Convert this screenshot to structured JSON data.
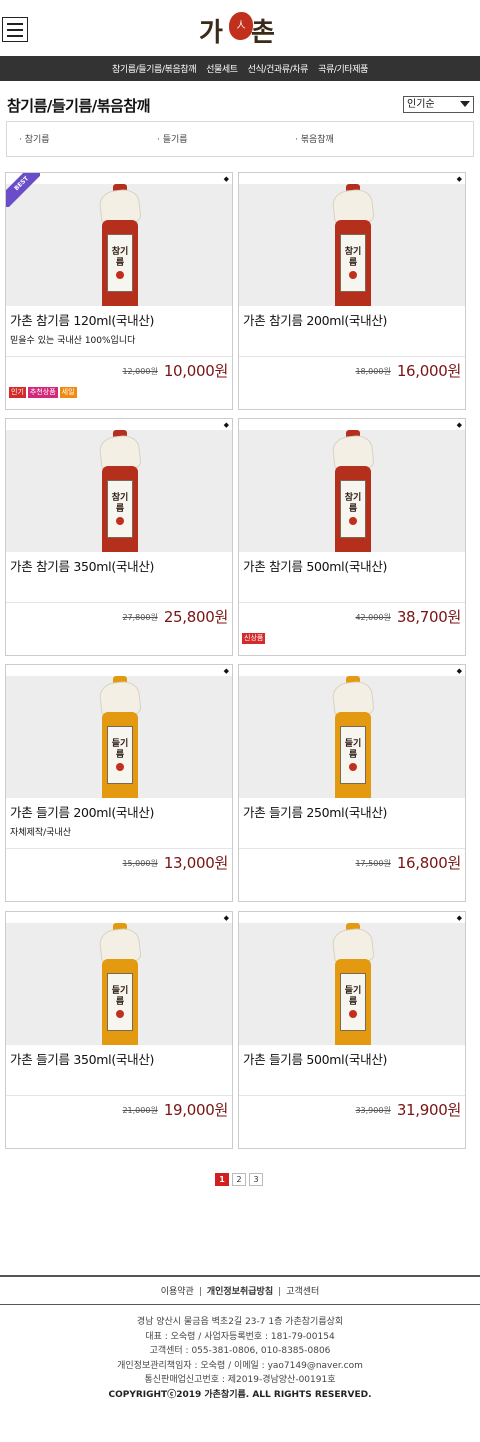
{
  "header": {
    "logo": {
      "text_left": "가",
      "text_right": "촌",
      "seal_text": "人"
    },
    "nav": [
      "참기름/들기름/볶음참깨",
      "선물세트",
      "선식/건과류/차류",
      "곡류/기타제품"
    ]
  },
  "category": {
    "title": "참기름/들기름/볶음참깨",
    "sort": {
      "selected": "인기순"
    },
    "subcategories": [
      "· 참기름",
      "· 들기름",
      "· 볶음참깨"
    ]
  },
  "products": [
    {
      "name": "가촌 참기름 120ml(국내산)",
      "desc": "믿을수 있는 국내산 100%입니다",
      "old_price": "12,000원",
      "price": "10,000원",
      "badges": [
        "인기",
        "추천상품",
        "세일"
      ],
      "best": "BEST",
      "oil": "sesame"
    },
    {
      "name": "가촌 참기름 200ml(국내산)",
      "desc": "",
      "old_price": "18,000원",
      "price": "16,000원",
      "badges": [],
      "oil": "sesame"
    },
    {
      "name": "가촌 참기름 350ml(국내산)",
      "desc": "",
      "old_price": "27,800원",
      "price": "25,800원",
      "badges": [],
      "oil": "sesame"
    },
    {
      "name": "가촌 참기름 500ml(국내산)",
      "desc": "",
      "old_price": "42,000원",
      "price": "38,700원",
      "badges": [
        "신상품"
      ],
      "oil": "sesame"
    },
    {
      "name": "가촌 들기름 200ml(국내산)",
      "desc": "자체제작/국내산",
      "old_price": "15,000원",
      "price": "13,000원",
      "badges": [],
      "oil": "perilla"
    },
    {
      "name": "가촌 들기름 250ml(국내산)",
      "desc": "",
      "old_price": "17,500원",
      "price": "16,800원",
      "badges": [],
      "oil": "perilla"
    },
    {
      "name": "가촌 들기름 350ml(국내산)",
      "desc": "",
      "old_price": "21,000원",
      "price": "19,000원",
      "badges": [],
      "oil": "perilla"
    },
    {
      "name": "가촌 들기름 500ml(국내산)",
      "desc": "",
      "old_price": "33,900원",
      "price": "31,900원",
      "badges": [],
      "oil": "perilla"
    }
  ],
  "bottle_labels": {
    "sesame": "참기름",
    "perilla": "들기름"
  },
  "colors": {
    "sesame": "#b5301c",
    "perilla": "#e39a10",
    "price": "#7a1414",
    "badge_인기": "#d42a2a",
    "badge_추천상품": "#d12a7a",
    "badge_세일": "#f08a10",
    "badge_신상품": "#d42a2a",
    "nav_bg": "#333333"
  },
  "pagination": {
    "pages": [
      "1",
      "2",
      "3"
    ],
    "current": "1"
  },
  "footer": {
    "links": [
      "이용약관",
      "개인정보취급방침",
      "고객센터"
    ],
    "info": [
      "경남 양산시 물금읍 벽초2길 23-7 1층 가촌참기름상회",
      "대표 : 오숙령 / 사업자등록번호 : 181-79-00154",
      "고객센터 : 055-381-0806, 010-8385-0806",
      "개인정보관리책임자 : 오숙령 / 이메일 : yao7149@naver.com",
      "통신판매업신고번호 : 제2019-경남양산-00191호"
    ],
    "copyright": "COPYRIGHTⓒ2019 가촌참기름. ALL RIGHTS RESERVED."
  }
}
